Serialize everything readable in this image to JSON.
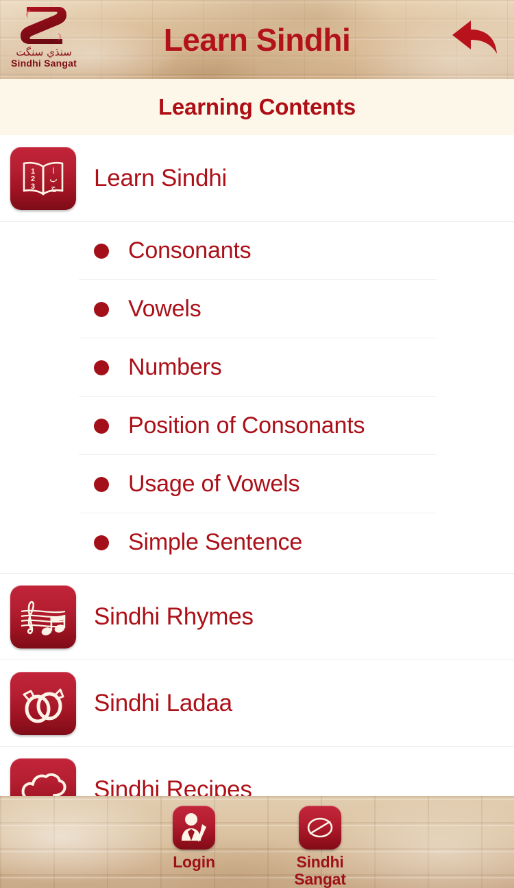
{
  "header": {
    "title": "Learn Sindhi",
    "back_icon": "back-arrow-icon",
    "logo": {
      "mark_icon": "sindhi-sangat-s-logo",
      "sindhi_text": "سنڌي سنگت",
      "name": "Sindhi Sangat"
    }
  },
  "subtitle": {
    "text": "Learning Contents"
  },
  "list": {
    "groups": [
      {
        "label": "Learn Sindhi",
        "icon": "open-book-icon",
        "children": [
          {
            "label": "Consonants"
          },
          {
            "label": "Vowels"
          },
          {
            "label": "Numbers"
          },
          {
            "label": "Position of Consonants"
          },
          {
            "label": "Usage of Vowels"
          },
          {
            "label": "Simple Sentence"
          }
        ]
      },
      {
        "label": "Sindhi Rhymes",
        "icon": "music-note-icon",
        "children": []
      },
      {
        "label": "Sindhi Ladaa",
        "icon": "wedding-rings-icon",
        "children": []
      },
      {
        "label": "Sindhi Recipes",
        "icon": "chef-hat-icon",
        "children": []
      }
    ]
  },
  "bottom_bar": {
    "items": [
      {
        "label": "Login",
        "icon": "user-pencil-icon"
      },
      {
        "label": "Sindhi\nSangat",
        "label_line1": "Sindhi",
        "label_line2": "Sangat",
        "icon": "sindhi-sangat-logo-icon"
      }
    ]
  },
  "colors": {
    "brand_red": "#ae1018",
    "title_red": "#b2131a",
    "tile_red_top": "#c3243a",
    "tile_red_bottom": "#7e0c18",
    "header_sand": "#dcc4a3",
    "subtitle_cream": "#fdf7e9",
    "divider": "#ececec"
  }
}
